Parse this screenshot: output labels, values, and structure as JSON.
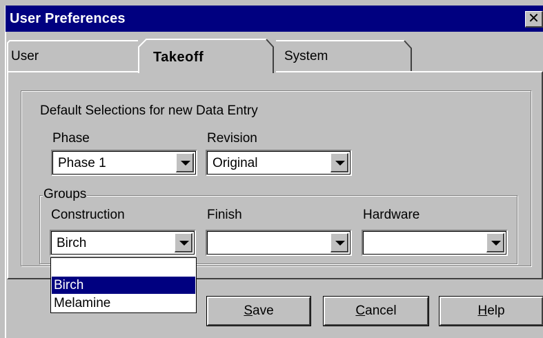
{
  "window": {
    "title": "User Preferences",
    "close_symbol": "✕"
  },
  "tabs": [
    {
      "label": "User",
      "active": false
    },
    {
      "label": "Takeoff",
      "active": true
    },
    {
      "label": "System",
      "active": false
    }
  ],
  "section_title": "Default Selections for new Data Entry",
  "phase": {
    "label": "Phase",
    "value": "Phase 1"
  },
  "revision": {
    "label": "Revision",
    "value": "Original"
  },
  "groups": {
    "legend": "Groups",
    "construction": {
      "label": "Construction",
      "value": "Birch"
    },
    "finish": {
      "label": "Finish",
      "value": ""
    },
    "hardware": {
      "label": "Hardware",
      "value": ""
    }
  },
  "dropdown": {
    "options": [
      "",
      "Birch",
      "Melamine"
    ],
    "selected_index": 1
  },
  "buttons": {
    "save": {
      "label": "Save",
      "access_key": "S"
    },
    "cancel": {
      "label": "Cancel",
      "access_key": "C"
    },
    "help": {
      "label": "Help",
      "access_key": "H"
    }
  },
  "colors": {
    "titlebar": "#000080",
    "face": "#c0c0c0",
    "selection": "#000080"
  }
}
